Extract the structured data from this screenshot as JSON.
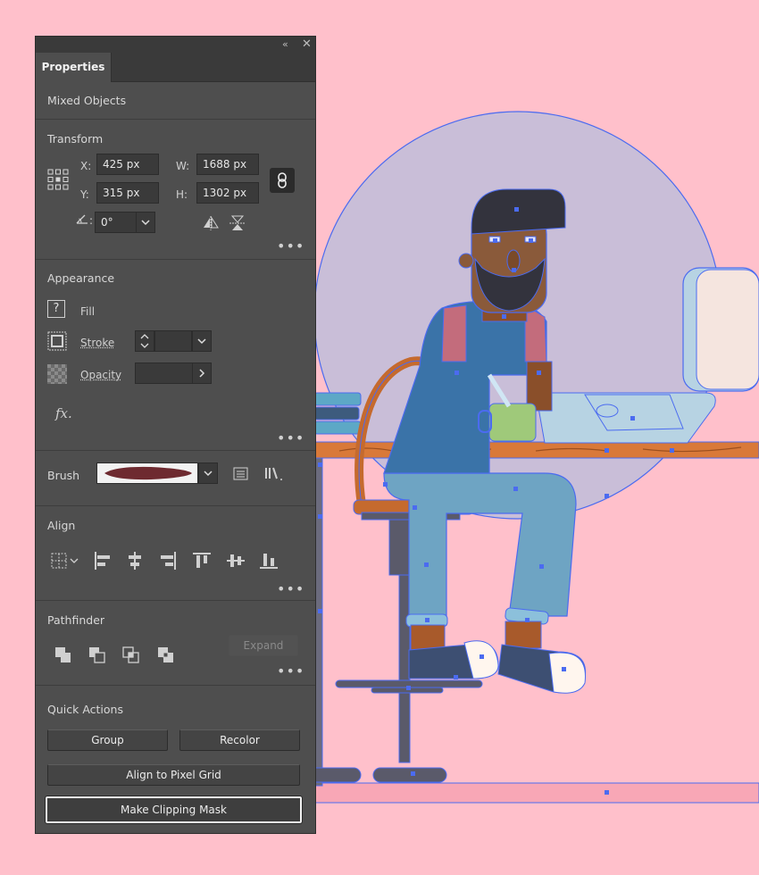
{
  "panel": {
    "title_tab": "Properties",
    "collapse_icon": "double-chevron-left-icon",
    "close_icon": "close-icon",
    "selection_label": "Mixed Objects"
  },
  "transform": {
    "section_title": "Transform",
    "x_label": "X:",
    "x_value": "425 px",
    "y_label": "Y:",
    "y_value": "315 px",
    "w_label": "W:",
    "w_value": "1688 px",
    "h_label": "H:",
    "h_value": "1302 px",
    "rotate_label": ":",
    "rotate_value": "0°"
  },
  "appearance": {
    "section_title": "Appearance",
    "fill_label": "Fill",
    "stroke_label": "Stroke",
    "opacity_label": "Opacity",
    "fx_label": "fx."
  },
  "brush": {
    "label": "Brush"
  },
  "align": {
    "section_title": "Align"
  },
  "pathfinder": {
    "section_title": "Pathfinder",
    "expand_label": "Expand"
  },
  "quick_actions": {
    "section_title": "Quick Actions",
    "group_label": "Group",
    "recolor_label": "Recolor",
    "pixel_grid_label": "Align to Pixel Grid",
    "clipping_mask_label": "Make Clipping Mask"
  },
  "colors": {
    "canvas_bg": "#ffc0cb",
    "selection": "#4b6bf0",
    "panel_bg": "#4e4e4e"
  }
}
